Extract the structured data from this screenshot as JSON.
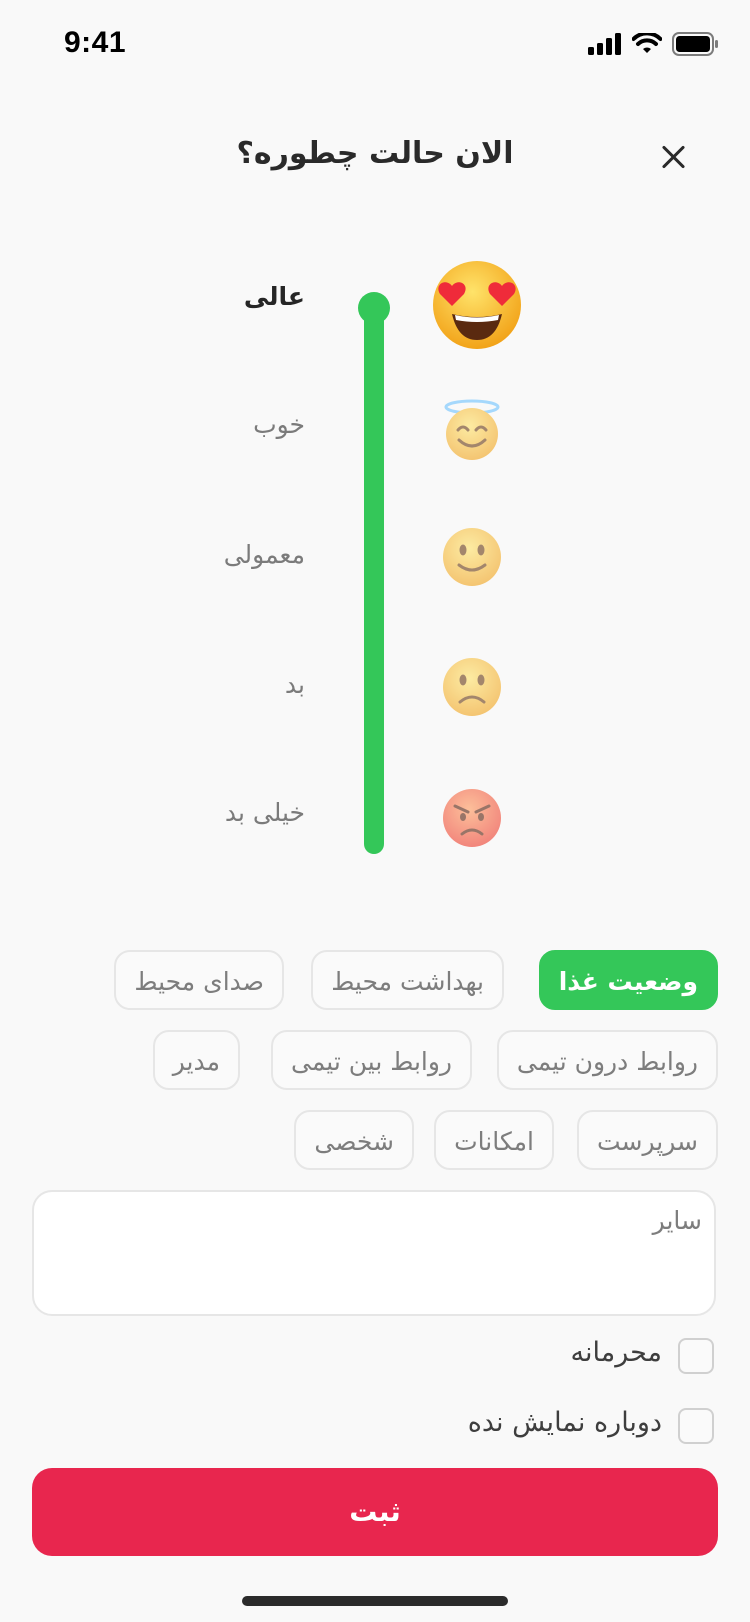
{
  "status_bar": {
    "time": "9:41"
  },
  "header": {
    "title": "الان حالت چطوره؟"
  },
  "mood_scale": {
    "selected_level": "عالی",
    "levels": [
      {
        "label": "عالی",
        "emoji": "😍",
        "icon": "heart-eyes-icon"
      },
      {
        "label": "خوب",
        "emoji": "😇",
        "icon": "halo-smile-icon"
      },
      {
        "label": "معمولی",
        "emoji": "🙂",
        "icon": "slight-smile-icon"
      },
      {
        "label": "بد",
        "emoji": "☹️",
        "icon": "frown-icon"
      },
      {
        "label": "خیلی بد",
        "emoji": "😡",
        "icon": "angry-icon"
      }
    ]
  },
  "topics": [
    {
      "label": "وضعیت غذا",
      "selected": true
    },
    {
      "label": "بهداشت محیط",
      "selected": false
    },
    {
      "label": "صدای محیط",
      "selected": false
    },
    {
      "label": "روابط درون تیمی",
      "selected": false
    },
    {
      "label": "روابط بین تیمی",
      "selected": false
    },
    {
      "label": "مدیر",
      "selected": false
    },
    {
      "label": "سرپرست",
      "selected": false
    },
    {
      "label": "امکانات",
      "selected": false
    },
    {
      "label": "شخصی",
      "selected": false
    }
  ],
  "other": {
    "placeholder": "سایر"
  },
  "options": {
    "confidential": {
      "label": "محرمانه",
      "checked": false
    },
    "dont_show_again": {
      "label": "دوباره نمایش نده",
      "checked": false
    }
  },
  "submit_label": "ثبت",
  "colors": {
    "accent_green": "#34c759",
    "submit_red": "#e8264e"
  }
}
